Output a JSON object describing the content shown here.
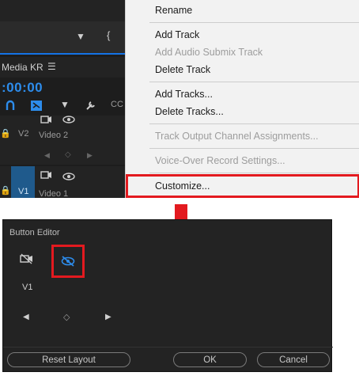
{
  "sequence_panel": {
    "name": "Media KR",
    "timecode": ":00:00",
    "tracks": [
      {
        "id": "V2",
        "name": "Video 2"
      },
      {
        "id": "V1",
        "name": "Video 1"
      }
    ]
  },
  "context_menu": {
    "items": [
      {
        "label": "Rename",
        "enabled": true
      },
      {
        "label": "Add Track",
        "enabled": true
      },
      {
        "label": "Add Audio Submix Track",
        "enabled": false
      },
      {
        "label": "Delete Track",
        "enabled": true
      },
      {
        "label": "Add Tracks...",
        "enabled": true
      },
      {
        "label": "Delete Tracks...",
        "enabled": true
      },
      {
        "label": "Track Output Channel Assignments...",
        "enabled": false
      },
      {
        "label": "Voice-Over Record Settings...",
        "enabled": false
      },
      {
        "label": "Customize...",
        "enabled": true,
        "highlighted": true
      }
    ]
  },
  "button_editor": {
    "title": "Button Editor",
    "track_label": "V1",
    "buttons": {
      "reset": "Reset Layout",
      "ok": "OK",
      "cancel": "Cancel"
    }
  },
  "colors": {
    "accent_red": "#e31a1f",
    "accent_blue": "#2d8ceb",
    "panel_dark": "#232323"
  }
}
